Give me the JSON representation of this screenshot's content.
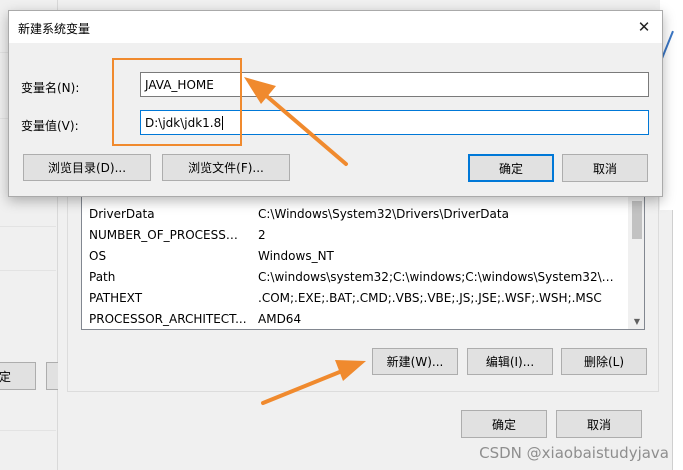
{
  "dialog": {
    "title": "新建系统变量",
    "var_name_label": "变量名(N):",
    "var_name_value": "JAVA_HOME",
    "var_value_label": "变量值(V):",
    "var_value_value": "D:\\jdk\\jdk1.8",
    "browse_dir_label": "浏览目录(D)...",
    "browse_file_label": "浏览文件(F)...",
    "ok_label": "确定",
    "cancel_label": "取消"
  },
  "env_list": {
    "rows": [
      {
        "name": "DriverData",
        "value": "C:\\Windows\\System32\\Drivers\\DriverData"
      },
      {
        "name": "NUMBER_OF_PROCESSORS",
        "value": "2"
      },
      {
        "name": "OS",
        "value": "Windows_NT"
      },
      {
        "name": "Path",
        "value": "C:\\windows\\system32;C:\\windows;C:\\windows\\System32\\Wbe..."
      },
      {
        "name": "PATHEXT",
        "value": ".COM;.EXE;.BAT;.CMD;.VBS;.VBE;.JS;.JSE;.WSF;.WSH;.MSC"
      },
      {
        "name": "PROCESSOR_ARCHITECT...",
        "value": "AMD64"
      }
    ],
    "new_label": "新建(W)...",
    "edit_label": "编辑(I)...",
    "delete_label": "删除(L)"
  },
  "env_window": {
    "ok_label": "确定",
    "cancel_label": "取消"
  },
  "left_window": {
    "button_fragment": "定"
  },
  "watermark": "CSDN @xiaobaistudyjava",
  "colors": {
    "annotation": "#f08a2e",
    "focus": "#0078d7"
  }
}
